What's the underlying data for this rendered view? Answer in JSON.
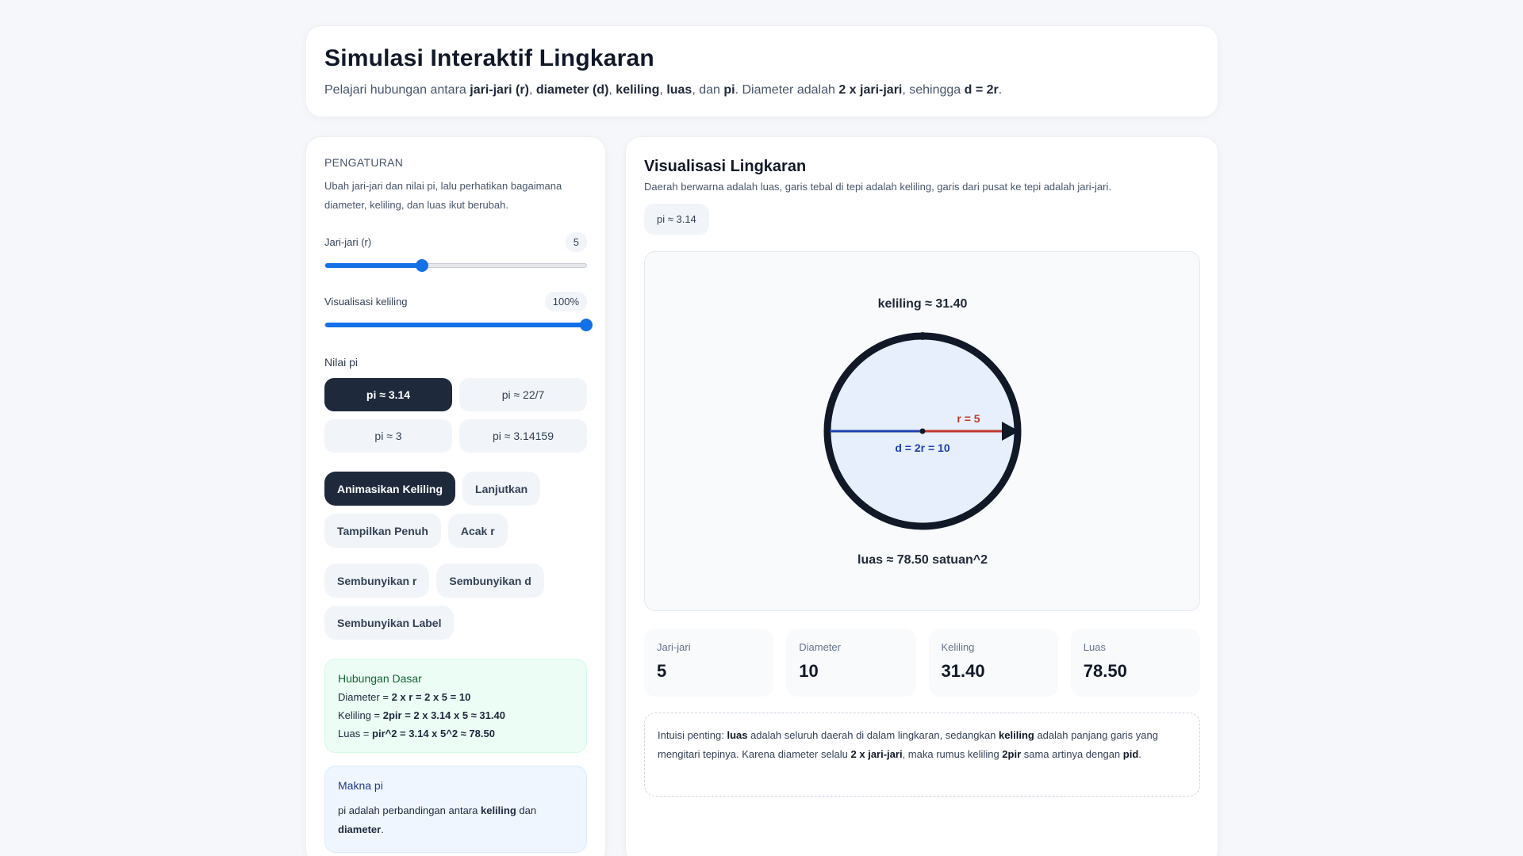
{
  "header": {
    "title": "Simulasi Interaktif Lingkaran",
    "subtitle": {
      "t1": "Pelajari hubungan antara ",
      "b1": "jari-jari (r)",
      "t2": ", ",
      "b2": "diameter (d)",
      "t3": ", ",
      "b3": "keliling",
      "t4": ", ",
      "b4": "luas",
      "t5": ", dan ",
      "b5": "pi",
      "t6": ". Diameter adalah ",
      "b6": "2 x jari-jari",
      "t7": ", sehingga ",
      "b7": "d = 2r",
      "t8": "."
    }
  },
  "settings": {
    "section_label": "PENGATURAN",
    "description": "Ubah jari-jari dan nilai pi, lalu perhatikan bagaimana diameter, keliling, dan luas ikut berubah.",
    "radius_slider": {
      "label": "Jari-jari (r)",
      "value": "5",
      "fraction": 0.37
    },
    "circumference_slider": {
      "label": "Visualisasi keliling",
      "value": "100%",
      "fraction": 1.0
    },
    "pi_label": "Nilai pi",
    "pi_options": [
      "pi ≈ 3.14",
      "pi ≈ 22/7",
      "pi ≈ 3",
      "pi ≈ 3.14159"
    ],
    "pi_selected": "pi ≈ 3.14",
    "buttons": {
      "animate": "Animasikan Keliling",
      "continue": "Lanjutkan",
      "show_full": "Tampilkan Penuh",
      "random_r": "Acak r",
      "hide_r": "Sembunyikan r",
      "hide_d": "Sembunyikan d",
      "hide_label": "Sembunyikan Label"
    },
    "relation": {
      "title": "Hubungan Dasar",
      "diameter": {
        "prefix": "Diameter = ",
        "formula": "2 x r = 2 x 5 = 10"
      },
      "keliling": {
        "prefix": "Keliling = ",
        "formula": "2pir = 2 x 3.14 x 5 ≈ 31.40"
      },
      "luas": {
        "prefix": "Luas = ",
        "formula": "pir^2 = 3.14 x 5^2 ≈ 78.50"
      }
    },
    "meaning": {
      "title": "Makna pi",
      "t1": "pi adalah perbandingan antara ",
      "b1": "keliling",
      "t2": " dan ",
      "b2": "diameter",
      "t3": "."
    }
  },
  "visualization": {
    "title": "Visualisasi Lingkaran",
    "description": "Daerah berwarna adalah luas, garis tebal di tepi adalah keliling, garis dari pusat ke tepi adalah jari-jari.",
    "pi_badge": "pi ≈ 3.14",
    "canvas": {
      "keliling_label": "keliling ≈ 31.40",
      "radius_label": "r = 5",
      "diameter_label": "d = 2r = 10",
      "luas_label": "luas ≈ 78.50 satuan^2"
    },
    "stats": [
      {
        "label": "Jari-jari",
        "value": "5"
      },
      {
        "label": "Diameter",
        "value": "10"
      },
      {
        "label": "Keliling",
        "value": "31.40"
      },
      {
        "label": "Luas",
        "value": "78.50"
      }
    ],
    "insight": {
      "t1": "Intuisi penting: ",
      "b1": "luas",
      "t2": " adalah seluruh daerah di dalam lingkaran, sedangkan ",
      "b2": "keliling",
      "t3": " adalah panjang garis yang mengitari tepinya. Karena diameter selalu ",
      "b3": "2 x jari-jari",
      "t4": ", maka rumus keliling ",
      "b4": "2pir",
      "t5": " sama artinya dengan ",
      "b5": "pid",
      "t6": "."
    }
  },
  "colors": {
    "accent_blue": "#1470e6",
    "dark": "#1e293b",
    "radius_red": "#c0392b",
    "diameter_blue": "#1e40af",
    "circle_fill": "#e6effb",
    "circle_stroke": "#111827"
  }
}
